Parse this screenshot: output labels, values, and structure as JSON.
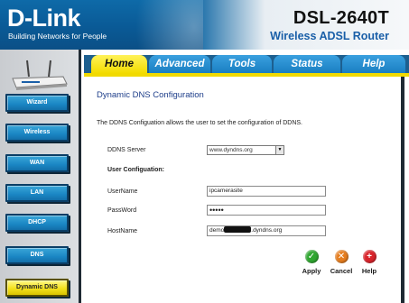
{
  "header": {
    "brand": "D-Link",
    "tagline": "Building Networks for People",
    "model": "DSL-2640T",
    "subtitle": "Wireless ADSL Router"
  },
  "tabs": [
    {
      "label": "Home",
      "active": true
    },
    {
      "label": "Advanced",
      "active": false
    },
    {
      "label": "Tools",
      "active": false
    },
    {
      "label": "Status",
      "active": false
    },
    {
      "label": "Help",
      "active": false
    }
  ],
  "sidebar": {
    "items": [
      {
        "label": "Wizard",
        "active": false
      },
      {
        "label": "Wireless",
        "active": false
      },
      {
        "label": "WAN",
        "active": false
      },
      {
        "label": "LAN",
        "active": false
      },
      {
        "label": "DHCP",
        "active": false
      },
      {
        "label": "DNS",
        "active": false
      },
      {
        "label": "Dynamic DNS",
        "active": true
      }
    ]
  },
  "main": {
    "title": "Dynamic DNS Configuration",
    "description": "The DDNS Configuation allows the user to set the configuration of DDNS.",
    "ddns_server": {
      "label": "DDNS Server",
      "value": "www.dyndns.org"
    },
    "user_config_heading": "User Configuation:",
    "username": {
      "label": "UserName",
      "value": "ipcamerasite"
    },
    "password": {
      "label": "PassWord",
      "value": "•••••"
    },
    "hostname": {
      "label": "HostName",
      "prefix": "demo",
      "suffix": ".dyndns.org"
    }
  },
  "actions": {
    "apply": "Apply",
    "cancel": "Cancel",
    "help": "Help"
  },
  "colors": {
    "header_blue": "#0a5a96",
    "tab_blue": "#1a7fc2",
    "active_yellow": "#f3dc00",
    "apply_green": "#2fa630",
    "cancel_orange": "#e67d1e",
    "help_red": "#d9232a"
  },
  "icons": {
    "apply": "check-icon",
    "cancel": "x-icon",
    "help": "plus-icon"
  }
}
